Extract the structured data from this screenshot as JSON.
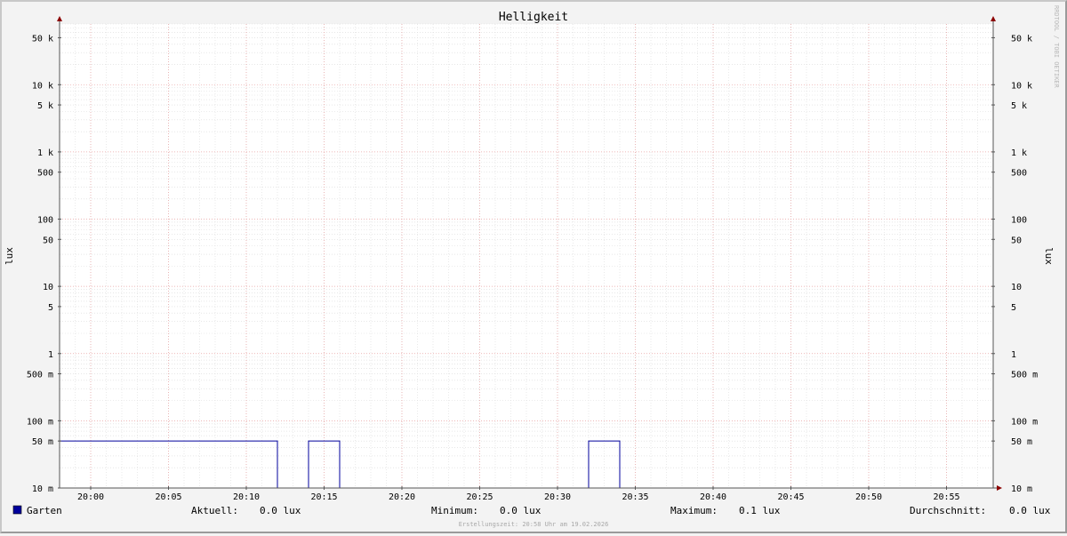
{
  "chart_data": {
    "type": "line",
    "title": "Helligkeit",
    "ylabel": "lux",
    "ylabel_right": "lux",
    "watermark": "RRDTOOL / TOBI OETIKER",
    "y_scale": "log",
    "ylim": [
      0.01,
      80000
    ],
    "y_ticks": [
      {
        "value": 50000,
        "label": "50 k"
      },
      {
        "value": 10000,
        "label": "10 k"
      },
      {
        "value": 5000,
        "label": "5 k"
      },
      {
        "value": 1000,
        "label": "1 k"
      },
      {
        "value": 500,
        "label": "500"
      },
      {
        "value": 100,
        "label": "100"
      },
      {
        "value": 50,
        "label": "50"
      },
      {
        "value": 10,
        "label": "10"
      },
      {
        "value": 5,
        "label": "5"
      },
      {
        "value": 1,
        "label": "1"
      },
      {
        "value": 0.5,
        "label": "500 m"
      },
      {
        "value": 0.1,
        "label": "100 m"
      },
      {
        "value": 0.05,
        "label": "50 m"
      },
      {
        "value": 0.01,
        "label": "10 m"
      }
    ],
    "x_start": "19:58",
    "x_end": "20:58",
    "x_ticks": [
      "20:00",
      "20:05",
      "20:10",
      "20:15",
      "20:20",
      "20:25",
      "20:30",
      "20:35",
      "20:40",
      "20:45",
      "20:50",
      "20:55"
    ],
    "series": [
      {
        "name": "Garten",
        "color": "#00009c",
        "points": [
          [
            "19:58",
            0.05
          ],
          [
            "20:12",
            0.05
          ],
          [
            "20:12",
            0.01
          ],
          [
            "20:14",
            0.01
          ],
          [
            "20:14",
            0.05
          ],
          [
            "20:16",
            0.05
          ],
          [
            "20:16",
            0.01
          ],
          [
            "20:32",
            0.01
          ],
          [
            "20:32",
            0.05
          ],
          [
            "20:34",
            0.05
          ],
          [
            "20:34",
            0.01
          ],
          [
            "20:58",
            0.01
          ]
        ]
      }
    ],
    "legend": {
      "series_name": "Garten",
      "swatch_color": "#00009c",
      "stats": [
        {
          "label": "Aktuell:",
          "value": "0.0 lux"
        },
        {
          "label": "Minimum:",
          "value": "0.0 lux"
        },
        {
          "label": "Maximum:",
          "value": "0.1 lux"
        },
        {
          "label": "Durchschnitt:",
          "value": "0.0 lux"
        }
      ]
    },
    "footer": "Erstellungszeit: 20:58 Uhr am 19.02.2026"
  }
}
